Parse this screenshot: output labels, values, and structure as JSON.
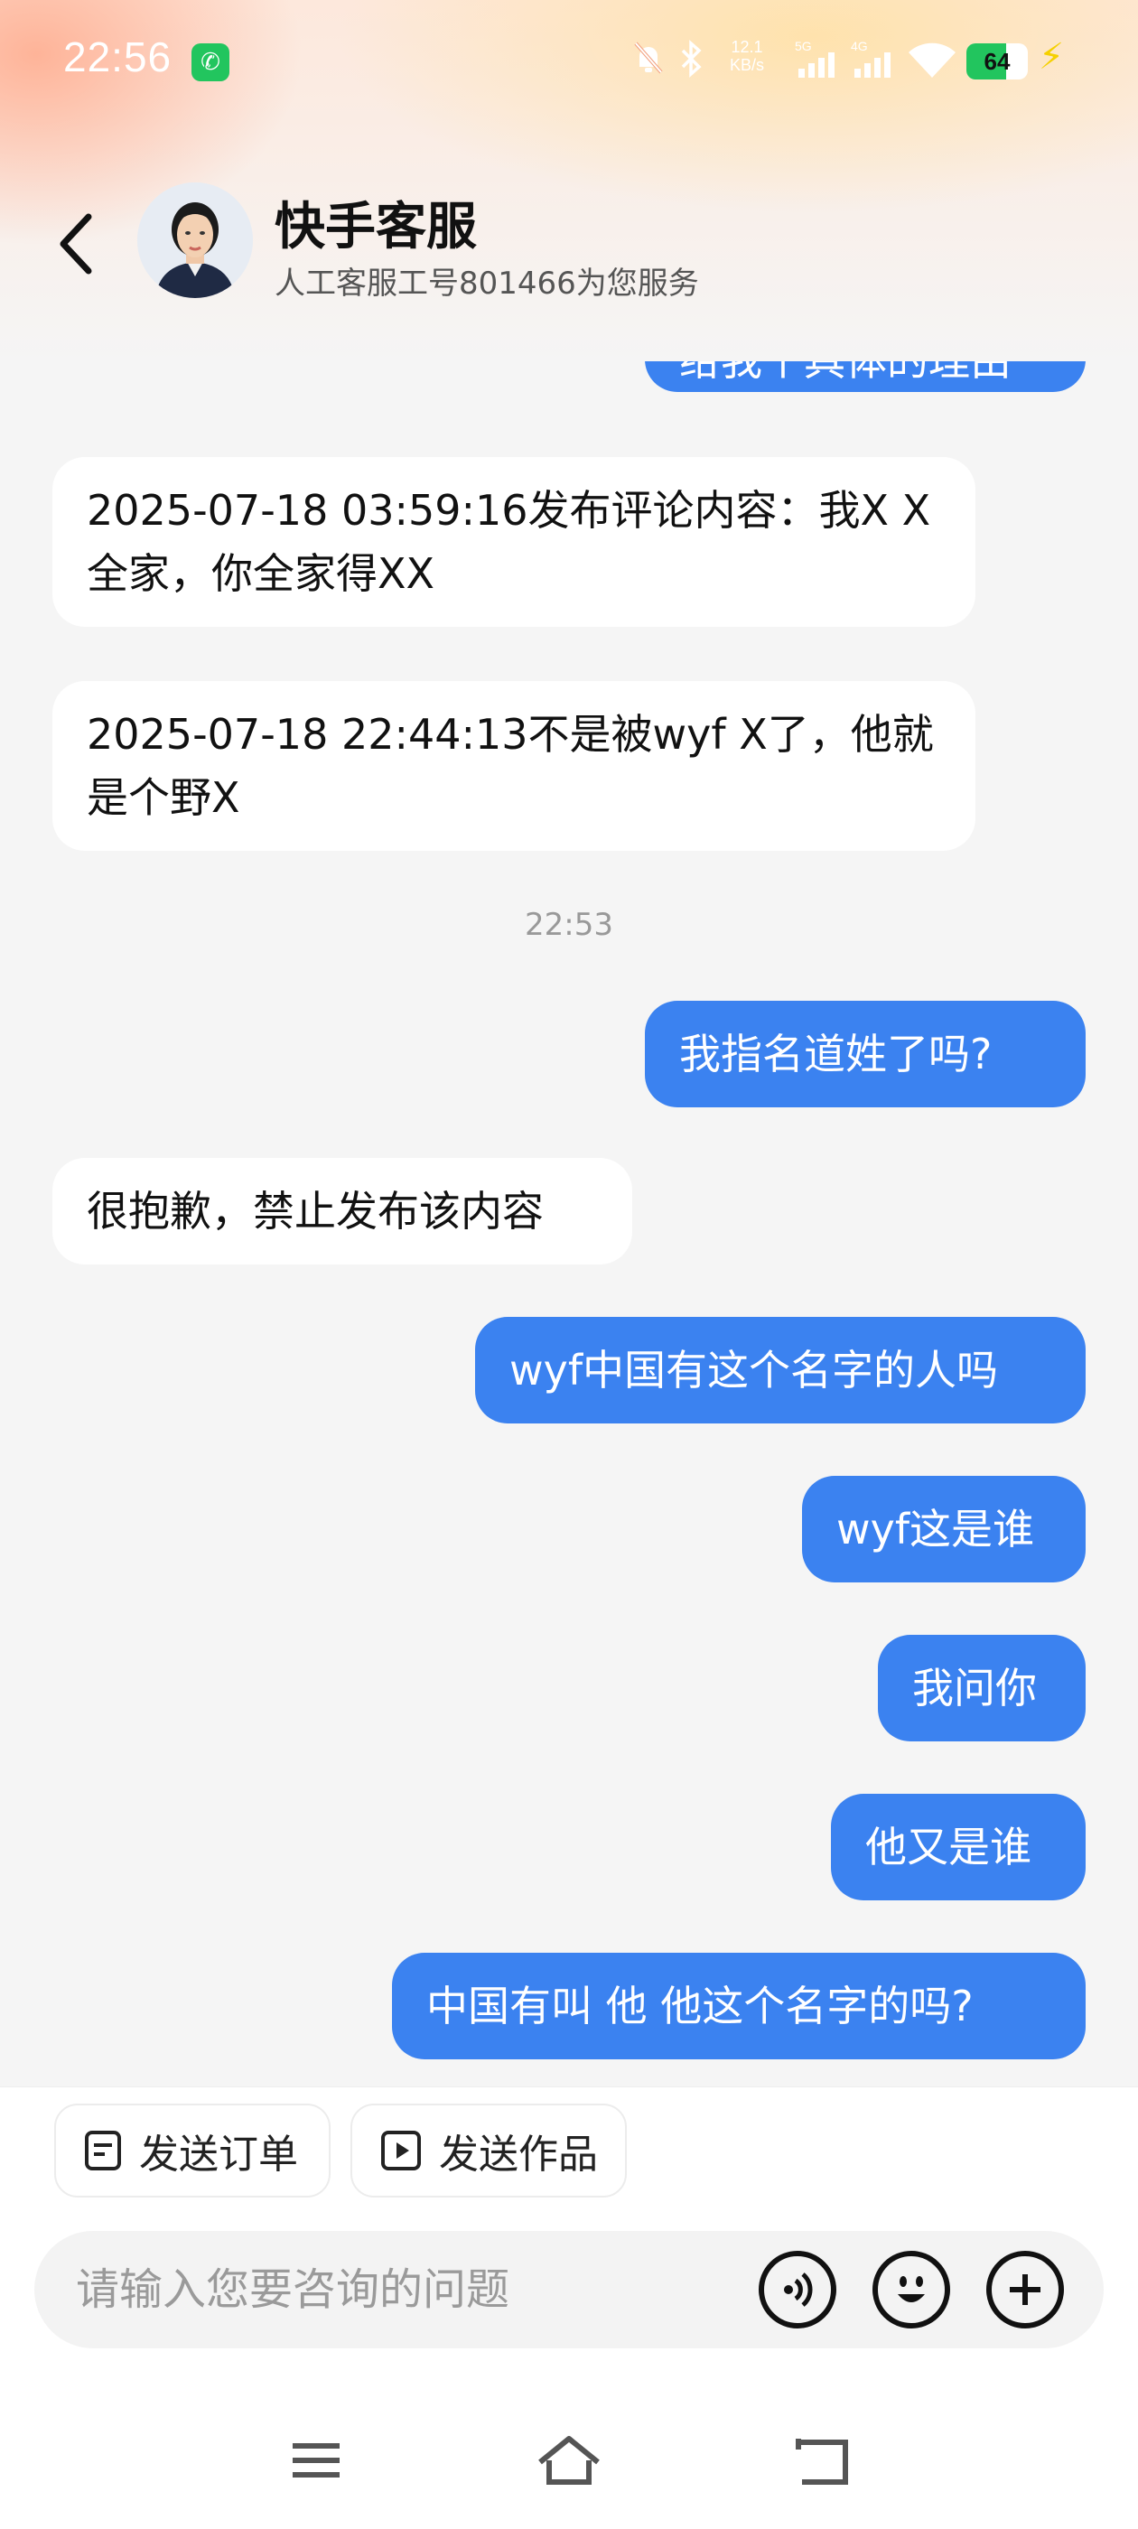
{
  "status_bar": {
    "time": "22:56",
    "speed_top": "12.1",
    "speed_unit": "KB/s",
    "net1": "5G",
    "net2": "4G",
    "battery_level": "64",
    "battery_percent": 64
  },
  "header": {
    "title": "快手客服",
    "subtitle": "人工客服工号801466为您服务"
  },
  "messages": [
    {
      "side": "out",
      "text": "给我个具体的理由"
    },
    {
      "side": "in",
      "text": "2025-07-18 03:59:16发布评论内容：我X X全家，你全家得XX"
    },
    {
      "side": "in",
      "text": "2025-07-18 22:44:13不是被wyf X了，他就是个野X"
    },
    {
      "side": "time",
      "text": "22:53"
    },
    {
      "side": "out",
      "text": "我指名道姓了吗?"
    },
    {
      "side": "in",
      "text": "很抱歉，禁止发布该内容"
    },
    {
      "side": "out",
      "text": "wyf中国有这个名字的人吗"
    },
    {
      "side": "out",
      "text": "wyf这是谁"
    },
    {
      "side": "out",
      "text": "我问你"
    },
    {
      "side": "out",
      "text": "他又是谁"
    },
    {
      "side": "out",
      "text": "中国有叫 他 他这个名字的吗?"
    }
  ],
  "quick_actions": {
    "send_order": "发送订单",
    "send_work": "发送作品"
  },
  "input": {
    "placeholder": "请输入您要咨询的问题"
  },
  "colors": {
    "outgoing_bubble": "#3b82f0",
    "incoming_bubble": "#ffffff",
    "background": "#f5f5f5"
  },
  "icons": [
    "back-arrow-icon",
    "voice-icon",
    "emoji-icon",
    "plus-icon",
    "order-icon",
    "video-icon",
    "menu-icon",
    "home-icon",
    "back-nav-icon"
  ]
}
